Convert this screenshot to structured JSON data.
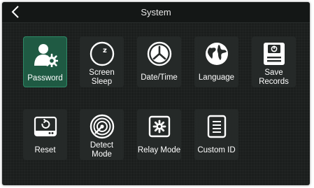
{
  "header": {
    "title": "System"
  },
  "tiles": [
    {
      "label": "Password",
      "icon": "password-icon"
    },
    {
      "label": "Screen Sleep",
      "line1": "Screen",
      "line2": "Sleep",
      "icon": "sleep-icon"
    },
    {
      "label": "Date/Time",
      "icon": "clock-icon"
    },
    {
      "label": "Language",
      "icon": "globe-icon"
    },
    {
      "label": "Save Records",
      "line1": "Save",
      "line2": "Records",
      "icon": "save-records-icon"
    },
    {
      "label": "Reset",
      "icon": "reset-icon"
    },
    {
      "label": "Detect Mode",
      "line1": "Detect",
      "line2": "Mode",
      "icon": "radar-icon"
    },
    {
      "label": "Relay Mode",
      "icon": "relay-icon"
    },
    {
      "label": "Custom ID",
      "icon": "custom-id-icon"
    }
  ],
  "colors": {
    "background": "#1b1e1d",
    "tile": "#252928",
    "active_tile": "#1f5a43",
    "text": "#ffffff"
  }
}
